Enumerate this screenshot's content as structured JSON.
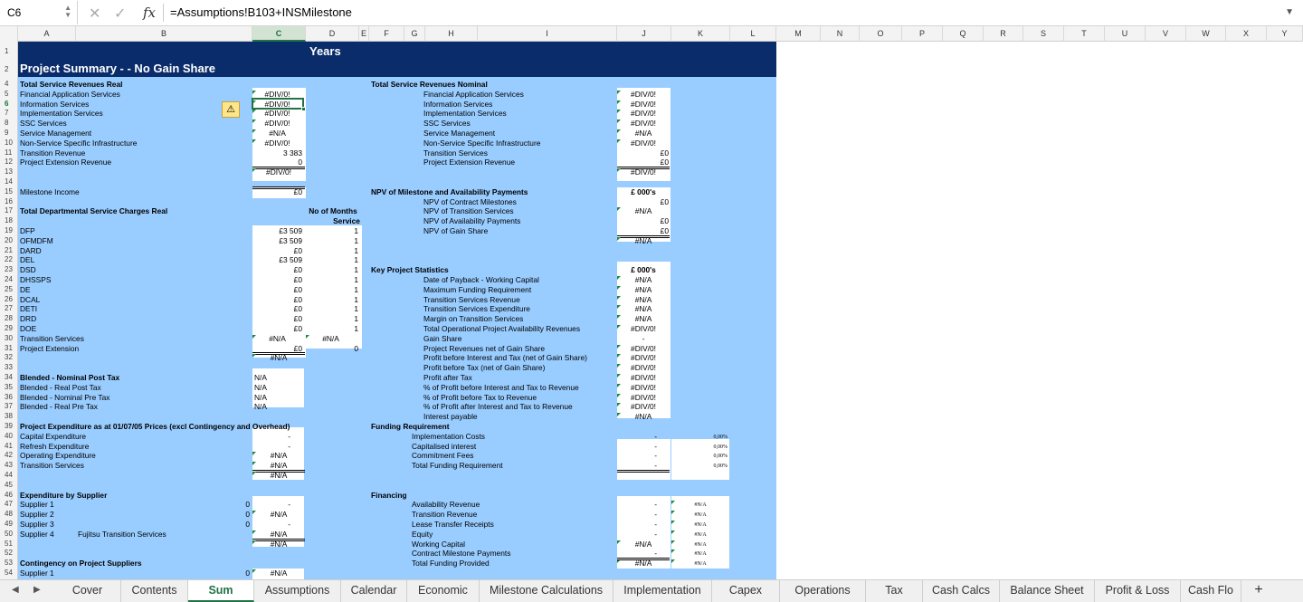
{
  "formula_bar": {
    "name_box": "C6",
    "formula": "=Assumptions!B103+INSMilestone",
    "fx": "fx",
    "cancel": "✕",
    "enter": "✓"
  },
  "columns": [
    "A",
    "B",
    "C",
    "D",
    "E",
    "F",
    "G",
    "H",
    "I",
    "J",
    "K",
    "L",
    "M",
    "N",
    "O",
    "P",
    "Q",
    "R",
    "S",
    "T",
    "U",
    "V",
    "W",
    "X",
    "Y"
  ],
  "rows": [
    "1",
    "2",
    "4",
    "5",
    "6",
    "7",
    "8",
    "9",
    "10",
    "11",
    "12",
    "13",
    "14",
    "15",
    "16",
    "17",
    "18",
    "19",
    "20",
    "21",
    "22",
    "23",
    "24",
    "25",
    "26",
    "27",
    "28",
    "29",
    "30",
    "31",
    "32",
    "33",
    "34",
    "35",
    "36",
    "37",
    "38",
    "39",
    "40",
    "41",
    "42",
    "43",
    "44",
    "45",
    "46",
    "47",
    "48",
    "49",
    "50",
    "51",
    "52",
    "53",
    "54"
  ],
  "header": {
    "years": "Years",
    "title": "Project Summary -  - No Gain Share"
  },
  "left": {
    "rev_real_title": "Total Service Revenues Real",
    "rev_items": [
      "Financial Application Services",
      "Information Services",
      "Implementation Services",
      "SSC Services",
      "Service Management",
      "Non-Service Specific Infrastructure",
      "Transition Revenue",
      "Project Extension Revenue"
    ],
    "rev_values": [
      "#DIV/0!",
      "#DIV/0!",
      "#DIV/0!",
      "#DIV/0!",
      "#N/A",
      "#DIV/0!",
      "3 383",
      "0"
    ],
    "rev_total": "#DIV/0!",
    "milestone_label": "Milestone Income",
    "milestone_value": "£0",
    "dept_title": "Total Departmental Service Charges Real",
    "months_h1": "No of Months",
    "months_h2": "Service",
    "dept_items": [
      "DFP",
      "OFMDFM",
      "DARD",
      "DEL",
      "DSD",
      "DHSSPS",
      "DE",
      "DCAL",
      "DETI",
      "DRD",
      "DOE",
      "Transition Services",
      "Project Extension"
    ],
    "dept_values": [
      "£3 509",
      "£3 509",
      "£0",
      "£3 509",
      "£0",
      "£0",
      "£0",
      "£0",
      "£0",
      "£0",
      "£0",
      "#N/A",
      "£0"
    ],
    "dept_months": [
      "1",
      "1",
      "1",
      "1",
      "1",
      "1",
      "1",
      "1",
      "1",
      "1",
      "1",
      "#N/A",
      "0"
    ],
    "dept_total": "#N/A",
    "blended_items": [
      "Blended - Nominal Post Tax",
      "Blended - Real Post Tax",
      "Blended - Nominal Pre Tax",
      "Blended - Real Pre Tax"
    ],
    "blended_values": [
      "N/A",
      "N/A",
      "N/A",
      "N/A"
    ],
    "exp_title": "Project Expenditure as at 01/07/05 Prices (excl Contingency and Overhead)",
    "exp_items": [
      "Capital Expenditure",
      "Refresh Expenditure",
      "Operating Expenditure",
      "Transition Services"
    ],
    "exp_values": [
      "-",
      "-",
      "#N/A",
      "#N/A"
    ],
    "exp_total": "#N/A",
    "supplier_title": "Expenditure by Supplier",
    "supplier_items": [
      "Supplier 1",
      "Supplier 2",
      "Supplier 3",
      "Supplier 4"
    ],
    "supplier_extra": "Fujitsu Transition Services",
    "supplier_zero": [
      "0",
      "0",
      "0"
    ],
    "supplier_values": [
      "-",
      "#N/A",
      "-",
      "#N/A"
    ],
    "supplier_total": "#N/A",
    "contingency_title": "Contingency on Project Suppliers",
    "contingency_item": "Supplier 1",
    "contingency_zero": "0",
    "contingency_value": "#N/A"
  },
  "right": {
    "nom_title": "Total Service Revenues Nominal",
    "nom_items": [
      "Financial Application Services",
      "Information Services",
      "Implementation Services",
      "SSC Services",
      "Service Management",
      "Non-Service Specific Infrastructure",
      "Transition Services",
      "Project Extension Revenue"
    ],
    "nom_values": [
      "#DIV/0!",
      "#DIV/0!",
      "#DIV/0!",
      "#DIV/0!",
      "#N/A",
      "#DIV/0!",
      "£0",
      "£0"
    ],
    "nom_total": "#DIV/0!",
    "npv_title": "NPV of Milestone and Availability Payments",
    "npv_unit": "£ 000's",
    "npv_items": [
      "NPV of Contract Milestones",
      "NPV of Transition Services",
      "NPV of Availability Payments",
      "NPV of Gain Share"
    ],
    "npv_values": [
      "£0",
      "#N/A",
      "£0",
      "£0"
    ],
    "npv_total": "#N/A",
    "kps_title": "Key Project Statistics",
    "kps_unit": "£ 000's",
    "kps_items": [
      "Date of Payback - Working Capital",
      "Maximum Funding Requirement",
      "Transition Services Revenue",
      "Transition Services Expenditure",
      "Margin on Transition Services",
      "Total Operational Project Availability Revenues",
      "Gain Share",
      "Project Revenues net of Gain Share",
      "Profit before Interest and Tax (net of Gain Share)",
      "Profit before Tax (net of Gain Share)",
      "Profit after Tax",
      "% of Profit before Interest and Tax to Revenue",
      "% of Profit before Tax to Revenue",
      "% of Profit after Interest and Tax to Revenue",
      "Interest payable"
    ],
    "kps_values": [
      "#N/A",
      "#N/A",
      "#N/A",
      "#N/A",
      "#N/A",
      "#DIV/0!",
      "-",
      "#DIV/0!",
      "#DIV/0!",
      "#DIV/0!",
      "#DIV/0!",
      "#DIV/0!",
      "#DIV/0!",
      "#DIV/0!",
      "#N/A"
    ],
    "fund_title": "Funding Requirement",
    "fund_items": [
      "Implementation Costs",
      "Capitalised interest",
      "Commitment Fees",
      "Total Funding Requirement"
    ],
    "fund_values": [
      "-",
      "-",
      "-",
      "-"
    ],
    "fund_pct": [
      "0,00%",
      "0,00%",
      "0,00%",
      "0,00%"
    ],
    "fin_title": "Financing",
    "fin_items": [
      "Availability Revenue",
      "Transition Revenue",
      "Lease Transfer Receipts",
      "Equity",
      "Working Capital",
      "Contract  Milestone Payments",
      "Total Funding Provided"
    ],
    "fin_values": [
      "-",
      "-",
      "-",
      "-",
      "#N/A",
      "-",
      "#N/A"
    ],
    "fin_k": [
      "#N/A",
      "#N/A",
      "#N/A",
      "#N/A",
      "#N/A",
      "#N/A",
      "#N/A"
    ]
  },
  "warning_icon": "⚠",
  "sheet_tabs": {
    "prev": "◀",
    "next": "▶",
    "add": "+",
    "items": [
      "Cover",
      "Contents",
      "Sum",
      "Assumptions",
      "Calendar",
      "Economic",
      "Milestone Calculations",
      "Implementation",
      "Capex",
      "Operations",
      "Tax",
      "Cash Calcs",
      "Balance Sheet",
      "Profit & Loss",
      "Cash Flo"
    ],
    "active": "Sum"
  }
}
